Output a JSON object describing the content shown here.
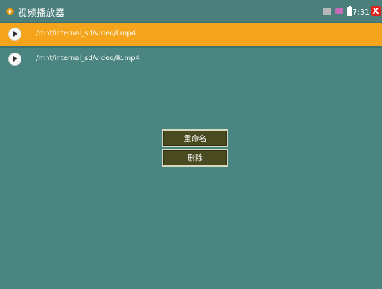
{
  "window": {
    "title": "视频播放器"
  },
  "status_bar": {
    "time": "07:31",
    "icons": [
      "sd-card-icon",
      "plug-icon",
      "battery-icon",
      "close-icon"
    ],
    "close_glyph": "X"
  },
  "files": [
    {
      "path": "/mnt/internal_sd/video/l.mp4",
      "selected": true
    },
    {
      "path": "/mnt/internal_sd/video/lk.mp4",
      "selected": false
    }
  ],
  "context_menu": {
    "items": [
      {
        "label": "重命名"
      },
      {
        "label": "删除"
      }
    ]
  },
  "colors": {
    "background": "#4a8581",
    "selected_row": "#f5a51c",
    "menu_button": "#4a4a20",
    "close_button": "#e0211c"
  }
}
